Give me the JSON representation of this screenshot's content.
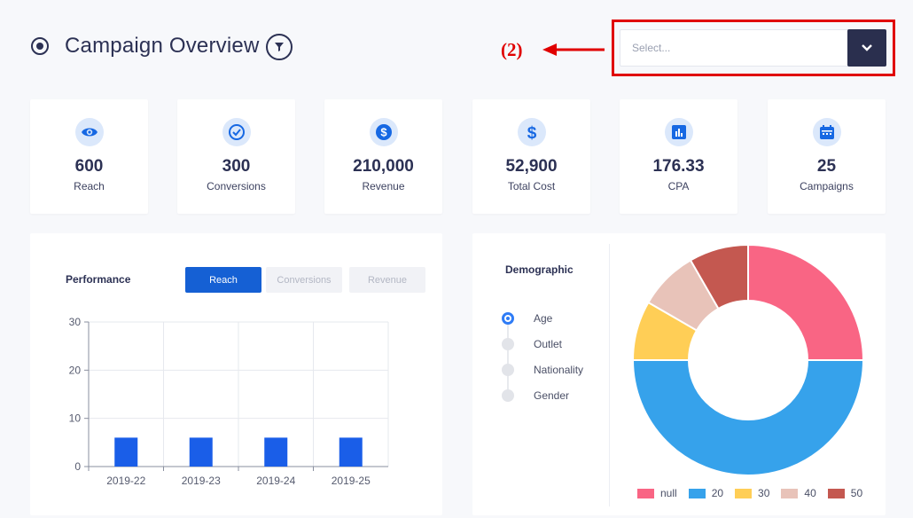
{
  "header": {
    "title": "Campaign Overview",
    "annotation": "(2)",
    "select_placeholder": "Select..."
  },
  "kpis": [
    {
      "value": "600",
      "label": "Reach",
      "icon": "eye-icon"
    },
    {
      "value": "300",
      "label": "Conversions",
      "icon": "check-circle-icon"
    },
    {
      "value": "210,000",
      "label": "Revenue",
      "icon": "dollar-circle-icon"
    },
    {
      "value": "52,900",
      "label": "Total Cost",
      "icon": "dollar-icon"
    },
    {
      "value": "176.33",
      "label": "CPA",
      "icon": "bar-chart-icon"
    },
    {
      "value": "25",
      "label": "Campaigns",
      "icon": "calendar-icon"
    }
  ],
  "performance": {
    "title": "Performance",
    "tabs": [
      "Reach",
      "Conversions",
      "Revenue"
    ],
    "active_tab": "Reach"
  },
  "demographic": {
    "title": "Demographic",
    "options": [
      "Age",
      "Outlet",
      "Nationality",
      "Gender"
    ],
    "selected": "Age"
  },
  "colors": {
    "accent": "#1560d4",
    "navy": "#2a2f4e",
    "annotation_red": "#e00000"
  },
  "chart_data": [
    {
      "type": "bar",
      "categories": [
        "2019-22",
        "2019-23",
        "2019-24",
        "2019-25"
      ],
      "values": [
        6,
        6,
        6,
        6
      ],
      "title": "",
      "xlabel": "",
      "ylabel": "",
      "ylim": [
        0,
        30
      ],
      "yticks": [
        0,
        10,
        20,
        30
      ],
      "grid": true,
      "color": "#1a5ee8"
    },
    {
      "type": "pie",
      "donut": true,
      "labels": [
        "null",
        "20",
        "30",
        "40",
        "50"
      ],
      "values": [
        25,
        50,
        8.33,
        8.33,
        8.33
      ],
      "colors": [
        "#f96584",
        "#36a2eb",
        "#ffce56",
        "#e8c3b9",
        "#c45850"
      ],
      "legend": "bottom"
    }
  ]
}
